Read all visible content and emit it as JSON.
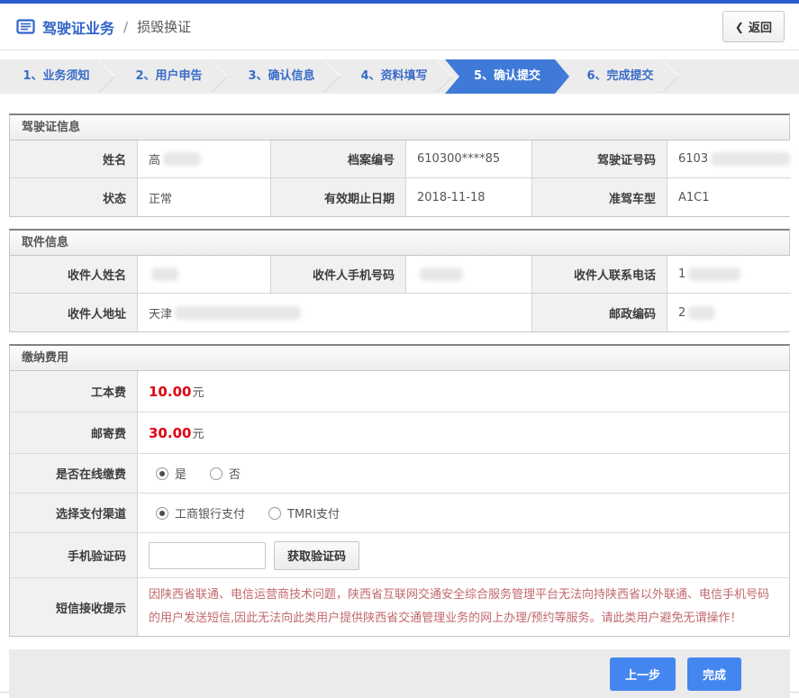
{
  "header": {
    "title": "驾驶证业务",
    "separator": "/",
    "subtitle": "损毁换证",
    "back": {
      "chevron": "❮",
      "label": "返回"
    }
  },
  "steps": [
    {
      "label": "1、业务须知",
      "active": false
    },
    {
      "label": "2、用户申告",
      "active": false
    },
    {
      "label": "3、确认信息",
      "active": false
    },
    {
      "label": "4、资料填写",
      "active": false
    },
    {
      "label": "5、确认提交",
      "active": true
    },
    {
      "label": "6、完成提交",
      "active": false
    }
  ],
  "license_info": {
    "title": "驾驶证信息",
    "name_label": "姓名",
    "name_value_visible": "高",
    "file_no_label": "档案编号",
    "file_no_value": "610300****85",
    "license_no_label": "驾驶证号码",
    "license_no_value_visible": "6103",
    "status_label": "状态",
    "status_value": "正常",
    "expiry_label": "有效期止日期",
    "expiry_value": "2018-11-18",
    "class_label": "准驾车型",
    "class_value": "A1C1"
  },
  "pickup_info": {
    "title": "取件信息",
    "recipient_name_label": "收件人姓名",
    "recipient_name_value_visible": "",
    "mobile_label": "收件人手机号码",
    "mobile_value_visible": "",
    "phone_label": "收件人联系电话",
    "phone_value_visible": "1",
    "address_label": "收件人地址",
    "address_value_visible": "天津",
    "postal_label": "邮政编码",
    "postal_value_visible": "2"
  },
  "payment": {
    "title": "缴纳费用",
    "production_fee_label": "工本费",
    "production_fee_amount": "10.00",
    "postage_fee_label": "邮寄费",
    "postage_fee_amount": "30.00",
    "currency_unit": "元",
    "online_pay_label": "是否在线缴费",
    "online_pay_options": [
      {
        "label": "是",
        "checked": true
      },
      {
        "label": "否",
        "checked": false
      }
    ],
    "channel_label": "选择支付渠道",
    "channel_options": [
      {
        "label": "工商银行支付",
        "checked": true
      },
      {
        "label": "TMRI支付",
        "checked": false
      }
    ],
    "sms_code_label": "手机验证码",
    "sms_code_value": "",
    "get_code_button_label": "获取验证码",
    "notice_label": "短信接收提示",
    "notice_text": "因陕西省联通、电信运营商技术问题，陕西省互联网交通安全综合服务管理平台无法向持陕西省以外联通、电信手机号码的用户发送短信,因此无法向此类用户提供陕西省交通管理业务的网上办理/预约等服务。请此类用户避免无谓操作！"
  },
  "footer": {
    "prev_label": "上一步",
    "finish_label": "完成"
  },
  "colors": {
    "accent_blue": "#3f7ad8",
    "top_strip_blue": "#2a5ccc",
    "fee_red": "#e00011",
    "notice_red": "#c2686c",
    "label_cell_bg": "#f1f1f1"
  }
}
